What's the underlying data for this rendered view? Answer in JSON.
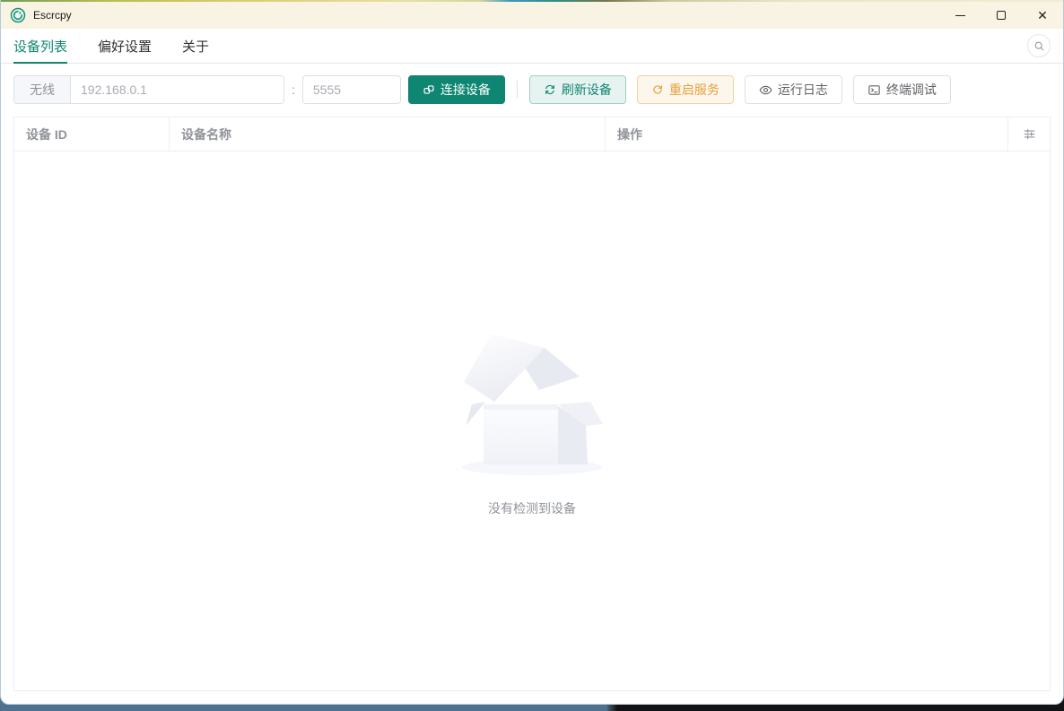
{
  "window": {
    "title": "Escrcpy"
  },
  "tabs": {
    "active_index": 0,
    "items": [
      {
        "label": "设备列表"
      },
      {
        "label": "偏好设置"
      },
      {
        "label": "关于"
      }
    ]
  },
  "toolbar": {
    "wireless_label": "无线",
    "host_placeholder": "192.168.0.1",
    "host_port_separator": ":",
    "port_placeholder": "5555",
    "connect_button": "连接设备",
    "refresh_button": "刷新设备",
    "restart_button": "重启服务",
    "logs_button": "运行日志",
    "terminal_button": "终端调试"
  },
  "device_table": {
    "columns": [
      {
        "label": "设备 ID"
      },
      {
        "label": "设备名称"
      },
      {
        "label": "操作"
      }
    ],
    "rows": [],
    "empty_text": "没有检测到设备"
  },
  "icons": {
    "app": "escrcpy-logo (teal circle with white swirl)",
    "connect": "link-icon (two chained rounded squares)",
    "refresh": "refresh-icon (two circular arrows)",
    "restart": "refresh-right-icon (C arrow)",
    "logs": "eye-icon",
    "terminal": "terminal-window-icon",
    "search": "magnifier-icon",
    "column_settings": "sliders-icon",
    "window": "minimize / maximize / close"
  },
  "colors": {
    "accent": "#0e8671",
    "warning": "#e6a23c",
    "titlebar_bg": "#f8f3e2",
    "table_border": "#ebeef5",
    "muted_text": "#909399"
  }
}
